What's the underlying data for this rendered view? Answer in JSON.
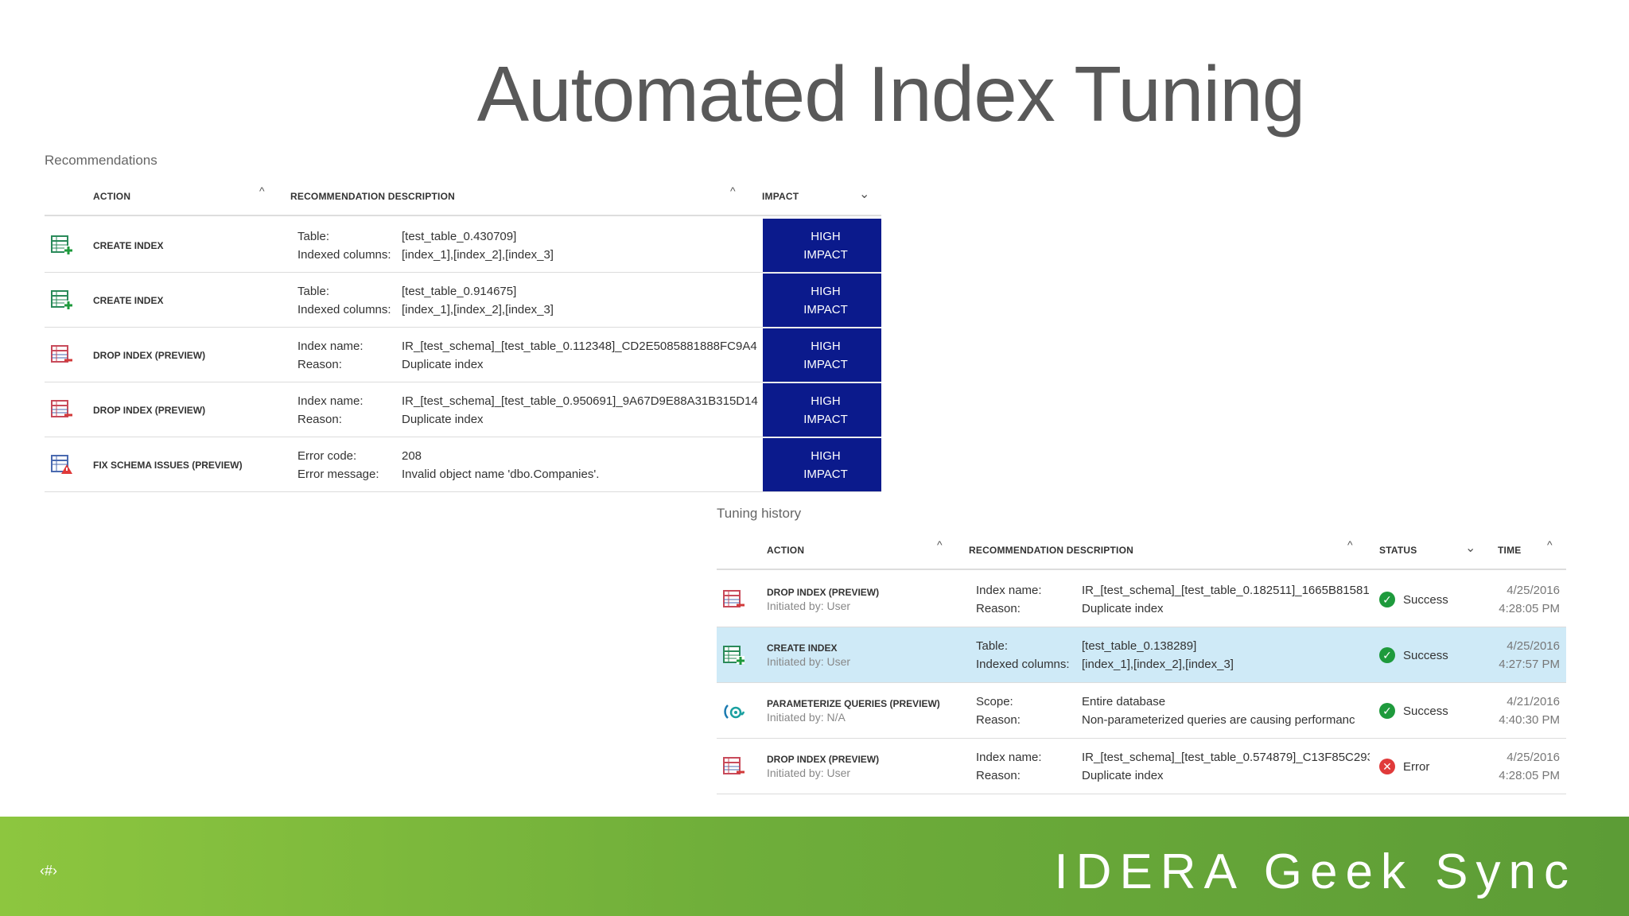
{
  "title": "Automated Index Tuning",
  "recommendations": {
    "label": "Recommendations",
    "headers": {
      "action": "ACTION",
      "description": "RECOMMENDATION DESCRIPTION",
      "impact": "IMPACT"
    },
    "rows": [
      {
        "icon": "create-index-icon",
        "action": "CREATE INDEX",
        "k1": "Table:",
        "v1": "[test_table_0.430709]",
        "k2": "Indexed columns:",
        "v2": "[index_1],[index_2],[index_3]",
        "impact1": "HIGH",
        "impact2": "IMPACT"
      },
      {
        "icon": "create-index-icon",
        "action": "CREATE INDEX",
        "k1": "Table:",
        "v1": "[test_table_0.914675]",
        "k2": "Indexed columns:",
        "v2": "[index_1],[index_2],[index_3]",
        "impact1": "HIGH",
        "impact2": "IMPACT"
      },
      {
        "icon": "drop-index-icon",
        "action": "DROP INDEX (PREVIEW)",
        "k1": "Index name:",
        "v1": "IR_[test_schema]_[test_table_0.112348]_CD2E5085881888FC9A4",
        "k2": "Reason:",
        "v2": "Duplicate index",
        "impact1": "HIGH",
        "impact2": "IMPACT"
      },
      {
        "icon": "drop-index-icon",
        "action": "DROP INDEX (PREVIEW)",
        "k1": "Index name:",
        "v1": "IR_[test_schema]_[test_table_0.950691]_9A67D9E88A31B315D14",
        "k2": "Reason:",
        "v2": "Duplicate index",
        "impact1": "HIGH",
        "impact2": "IMPACT"
      },
      {
        "icon": "schema-warning-icon",
        "action": "FIX SCHEMA ISSUES (PREVIEW)",
        "k1": "Error code:",
        "v1": "208",
        "k2": "Error message:",
        "v2": "Invalid object name 'dbo.Companies'.",
        "impact1": "HIGH",
        "impact2": "IMPACT"
      }
    ]
  },
  "history": {
    "label": "Tuning history",
    "headers": {
      "action": "ACTION",
      "description": "RECOMMENDATION DESCRIPTION",
      "status": "STATUS",
      "time": "TIME"
    },
    "rows": [
      {
        "icon": "drop-index-icon",
        "action": "DROP INDEX (PREVIEW)",
        "initiated": "Initiated by: User",
        "k1": "Index name:",
        "v1": "IR_[test_schema]_[test_table_0.182511]_1665B81581",
        "k2": "Reason:",
        "v2": "Duplicate index",
        "status": "Success",
        "date": "4/25/2016",
        "clock": "4:28:05 PM"
      },
      {
        "icon": "create-index-icon",
        "action": "CREATE INDEX",
        "initiated": "Initiated by: User",
        "k1": "Table:",
        "v1": "[test_table_0.138289]",
        "k2": "Indexed columns:",
        "v2": "[index_1],[index_2],[index_3]",
        "status": "Success",
        "date": "4/25/2016",
        "clock": "4:27:57 PM"
      },
      {
        "icon": "parameterize-icon",
        "action": "PARAMETERIZE QUERIES (PREVIEW)",
        "initiated": "Initiated by: N/A",
        "k1": "Scope:",
        "v1": "Entire database",
        "k2": "Reason:",
        "v2": "Non-parameterized queries are causing performanc",
        "status": "Success",
        "date": "4/21/2016",
        "clock": "4:40:30 PM"
      },
      {
        "icon": "drop-index-icon",
        "action": "DROP INDEX (PREVIEW)",
        "initiated": "Initiated by: User",
        "k1": "Index name:",
        "v1": "IR_[test_schema]_[test_table_0.574879]_C13F85C293",
        "k2": "Reason:",
        "v2": "Duplicate index",
        "status": "Error",
        "date": "4/25/2016",
        "clock": "4:28:05 PM"
      }
    ]
  },
  "footer": {
    "slide_number": "‹#›",
    "brand": "IDERA Geek Sync"
  },
  "colors": {
    "impact_bg": "#0b1a8c",
    "success": "#1e9a3c",
    "error": "#e03a3a",
    "footer_green": "#8dc63f",
    "selected_row": "#cfeaf7"
  }
}
